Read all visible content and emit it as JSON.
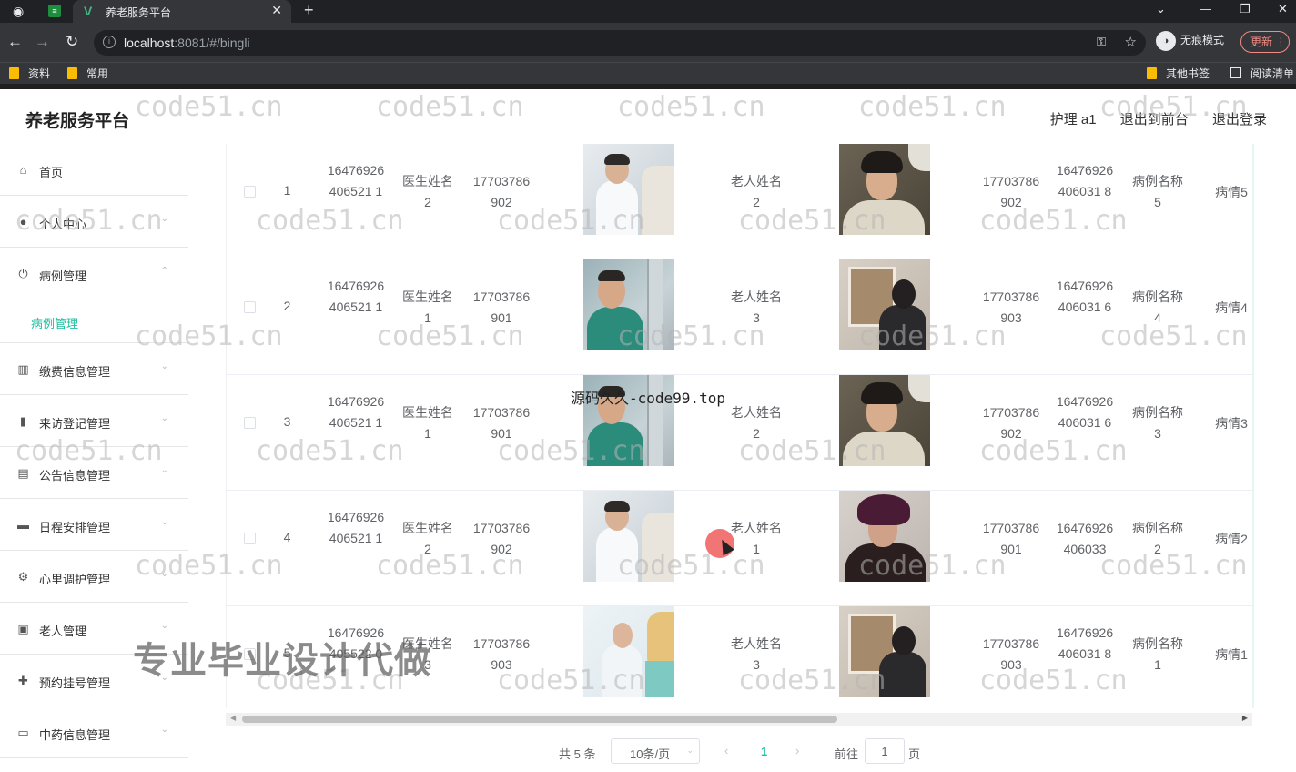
{
  "browser": {
    "tab_title": "养老服务平台",
    "url_host": "localhost",
    "url_rest": ":8081/#/bingli",
    "incognito_label": "无痕模式",
    "update_label": "更新",
    "bookmarks": [
      "资料",
      "常用"
    ],
    "bookmarks_right": [
      "其他书签",
      "阅读清单"
    ]
  },
  "header": {
    "brand": "养老服务平台",
    "user": "护理 a1",
    "to_front": "退出到前台",
    "logout": "退出登录"
  },
  "sidebar": {
    "items": [
      {
        "label": "首页",
        "icon": "home-icon"
      },
      {
        "label": "个人中心",
        "icon": "user-icon"
      },
      {
        "label": "病例管理",
        "icon": "power-icon"
      },
      {
        "label": "缴费信息管理",
        "icon": "bars-icon"
      },
      {
        "label": "来访登记管理",
        "icon": "chart-icon"
      },
      {
        "label": "公告信息管理",
        "icon": "clipboard-icon"
      },
      {
        "label": "日程安排管理",
        "icon": "briefcase-icon"
      },
      {
        "label": "心里调护管理",
        "icon": "gear-icon"
      },
      {
        "label": "老人管理",
        "icon": "document-icon"
      },
      {
        "label": "预约挂号管理",
        "icon": "grid-icon"
      },
      {
        "label": "中药信息管理",
        "icon": "card-icon"
      }
    ],
    "sub_item": "病例管理"
  },
  "table": {
    "rows": [
      {
        "idx": "1",
        "code": "16476926406521 1",
        "doctor": "医生姓名 2",
        "doctor_phone": "17703786902",
        "elder": "老人姓名 2",
        "elder_phone": "17703786902",
        "case_code": "16476926406031 8",
        "case_name": "病例名称 5",
        "condition": "病情5"
      },
      {
        "idx": "2",
        "code": "16476926406521 1",
        "doctor": "医生姓名 1",
        "doctor_phone": "17703786901",
        "elder": "老人姓名 3",
        "elder_phone": "17703786903",
        "case_code": "16476926406031 6",
        "case_name": "病例名称 4",
        "condition": "病情4"
      },
      {
        "idx": "3",
        "code": "16476926406521 1",
        "doctor": "医生姓名 1",
        "doctor_phone": "17703786901",
        "elder": "老人姓名 2",
        "elder_phone": "17703786902",
        "case_code": "16476926406031 6",
        "case_name": "病例名称 3",
        "condition": "病情3"
      },
      {
        "idx": "4",
        "code": "16476926406521 1",
        "doctor": "医生姓名 2",
        "doctor_phone": "17703786902",
        "elder": "老人姓名 1",
        "elder_phone": "17703786901",
        "case_code": "16476926406033",
        "case_name": "病例名称 2",
        "condition": "病情2"
      },
      {
        "idx": "5",
        "code": "16476926405522 0",
        "doctor": "医生姓名 3",
        "doctor_phone": "17703786903",
        "elder": "老人姓名 3",
        "elder_phone": "17703786903",
        "case_code": "16476926406031 8",
        "case_name": "病例名称 1",
        "condition": "病情1"
      }
    ]
  },
  "pagination": {
    "total": "共 5 条",
    "page_size": "10条/页",
    "current": "1",
    "goto_label": "前往",
    "goto_value": "1",
    "page_suffix": "页"
  },
  "overlay": {
    "watermark": "code51.cn",
    "center_text": "源码久久-code99.top",
    "banner": "专业毕业设计代做"
  }
}
